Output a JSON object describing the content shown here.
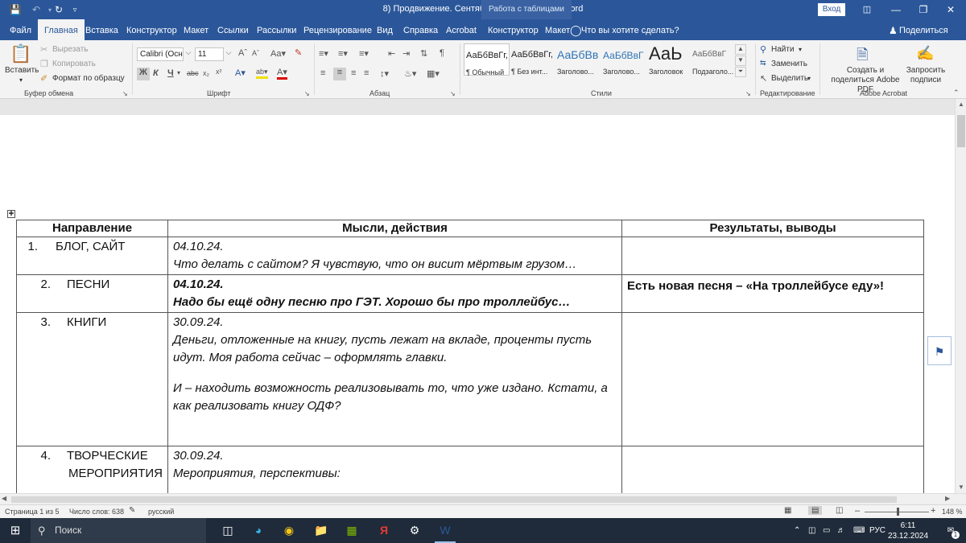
{
  "window": {
    "doc_title": "8) Продвижение. Сентябрь-октябрь, 2024  -  Word",
    "context_tab_title": "Работа с таблицами",
    "signin_label": "Вход"
  },
  "tabs": [
    "Файл",
    "Главная",
    "Вставка",
    "Конструктор",
    "Макет",
    "Ссылки",
    "Рассылки",
    "Рецензирование",
    "Вид",
    "Справка",
    "Acrobat",
    "Конструктор",
    "Макет"
  ],
  "tell_me": "Что вы хотите сделать?",
  "share": "Поделиться",
  "ribbon": {
    "clipboard": {
      "paste": "Вставить",
      "cut": "Вырезать",
      "copy": "Копировать",
      "format_painter": "Формат по образцу",
      "label": "Буфер обмена"
    },
    "font": {
      "font_name": "Calibri (Оснс",
      "font_size": "11",
      "label": "Шрифт"
    },
    "paragraph": {
      "label": "Абзац"
    },
    "styles": {
      "items": [
        {
          "sample": "АаБбВвГг,",
          "name": "¶ Обычный"
        },
        {
          "sample": "АаБбВвГг,",
          "name": "¶ Без инт..."
        },
        {
          "sample": "АаБбВв",
          "name": "Заголово..."
        },
        {
          "sample": "АаБбВвГ",
          "name": "Заголово..."
        },
        {
          "sample": "АаЬ",
          "name": "Заголовок"
        },
        {
          "sample": "АаБбВвГ",
          "name": "Подзаголо..."
        }
      ],
      "label": "Стили"
    },
    "editing": {
      "find": "Найти",
      "replace": "Заменить",
      "select": "Выделить",
      "label": "Редактирование"
    },
    "acrobat": {
      "create_share": "Создать и поделиться Adobe PDF",
      "request_sign": "Запросить подписи",
      "label": "Adobe Acrobat"
    }
  },
  "table": {
    "headers": [
      "Направление",
      "Мысли, действия",
      "Результаты, выводы"
    ],
    "rows": [
      {
        "num": "1.",
        "direction": "БЛОГ, САЙТ",
        "date": "04.10.24.",
        "lines": [
          "Что делать с сайтом? Я чувствую, что он висит мёртвым грузом…"
        ],
        "result": ""
      },
      {
        "num": "2.",
        "direction": "ПЕСНИ",
        "date": "04.10.24.",
        "lines": [
          "Надо бы ещё одну песню про ГЭТ. Хорошо бы про троллейбус…"
        ],
        "result": "Есть новая песня – «На троллейбусе еду»!"
      },
      {
        "num": "3.",
        "direction": "КНИГИ",
        "date": "30.09.24.",
        "lines": [
          "Деньги, отложенные на книгу, пусть лежат на вкладе, проценты пусть идут. Моя работа сейчас – оформлять главки.",
          "И – находить возможность реализовывать то, что уже издано. Кстати, а как реализовать книгу ОДФ?"
        ],
        "result": ""
      },
      {
        "num": "4.",
        "direction_line1": "ТВОРЧЕСКИЕ",
        "direction_line2": "МЕРОПРИЯТИЯ",
        "date": "30.09.24.",
        "lines": [
          "Мероприятия, перспективы:"
        ],
        "result": ""
      }
    ]
  },
  "status": {
    "page": "Страница 1 из 5",
    "words": "Число слов: 638",
    "language": "русский",
    "zoom": "148 %"
  },
  "taskbar": {
    "search": "Поиск",
    "lang": "РУС",
    "time": "6:11",
    "date": "23.12.2024",
    "notifications": "1"
  }
}
